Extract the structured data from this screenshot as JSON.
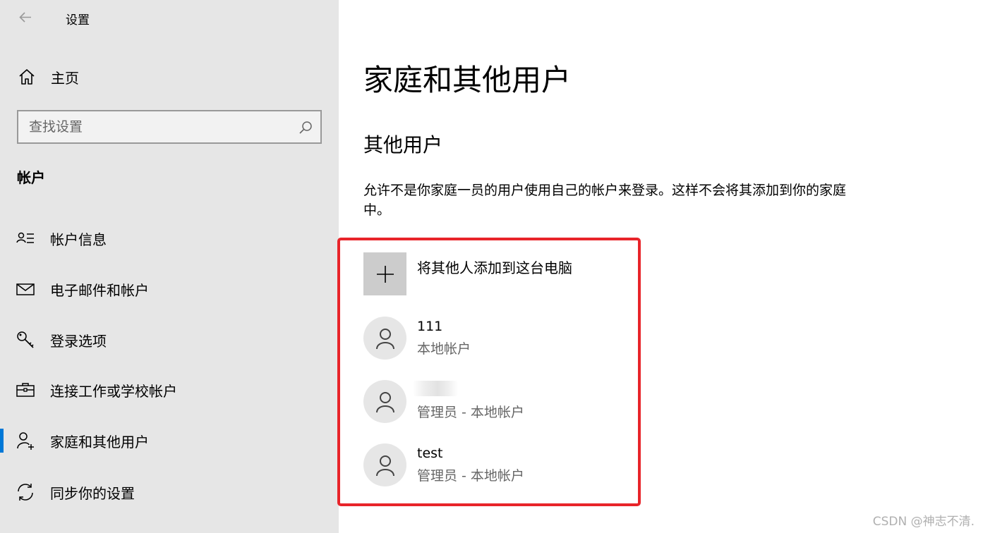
{
  "app": {
    "title": "设置"
  },
  "sidebar": {
    "home_label": "主页",
    "search_placeholder": "查找设置",
    "section_label": "帐户",
    "items": [
      {
        "label": "帐户信息",
        "icon": "account-info-icon",
        "selected": false
      },
      {
        "label": "电子邮件和帐户",
        "icon": "mail-icon",
        "selected": false
      },
      {
        "label": "登录选项",
        "icon": "key-icon",
        "selected": false
      },
      {
        "label": "连接工作或学校帐户",
        "icon": "briefcase-icon",
        "selected": false
      },
      {
        "label": "家庭和其他用户",
        "icon": "person-add-icon",
        "selected": true
      },
      {
        "label": "同步你的设置",
        "icon": "sync-icon",
        "selected": false
      }
    ]
  },
  "main": {
    "title": "家庭和其他用户",
    "section_title": "其他用户",
    "description": "允许不是你家庭一员的用户使用自己的帐户来登录。这样不会将其添加到你的家庭中。",
    "add_label": "将其他人添加到这台电脑",
    "users": [
      {
        "name": "111",
        "type": "本地帐户",
        "name_blurred": false
      },
      {
        "name": "",
        "type": "管理员 - 本地帐户",
        "name_blurred": true
      },
      {
        "name": "test",
        "type": "管理员 - 本地帐户",
        "name_blurred": false
      }
    ]
  },
  "colors": {
    "accent": "#0078d7",
    "highlight": "#e8242a",
    "sidebar_bg": "#e6e6e6"
  },
  "watermark": "CSDN @神志不清."
}
